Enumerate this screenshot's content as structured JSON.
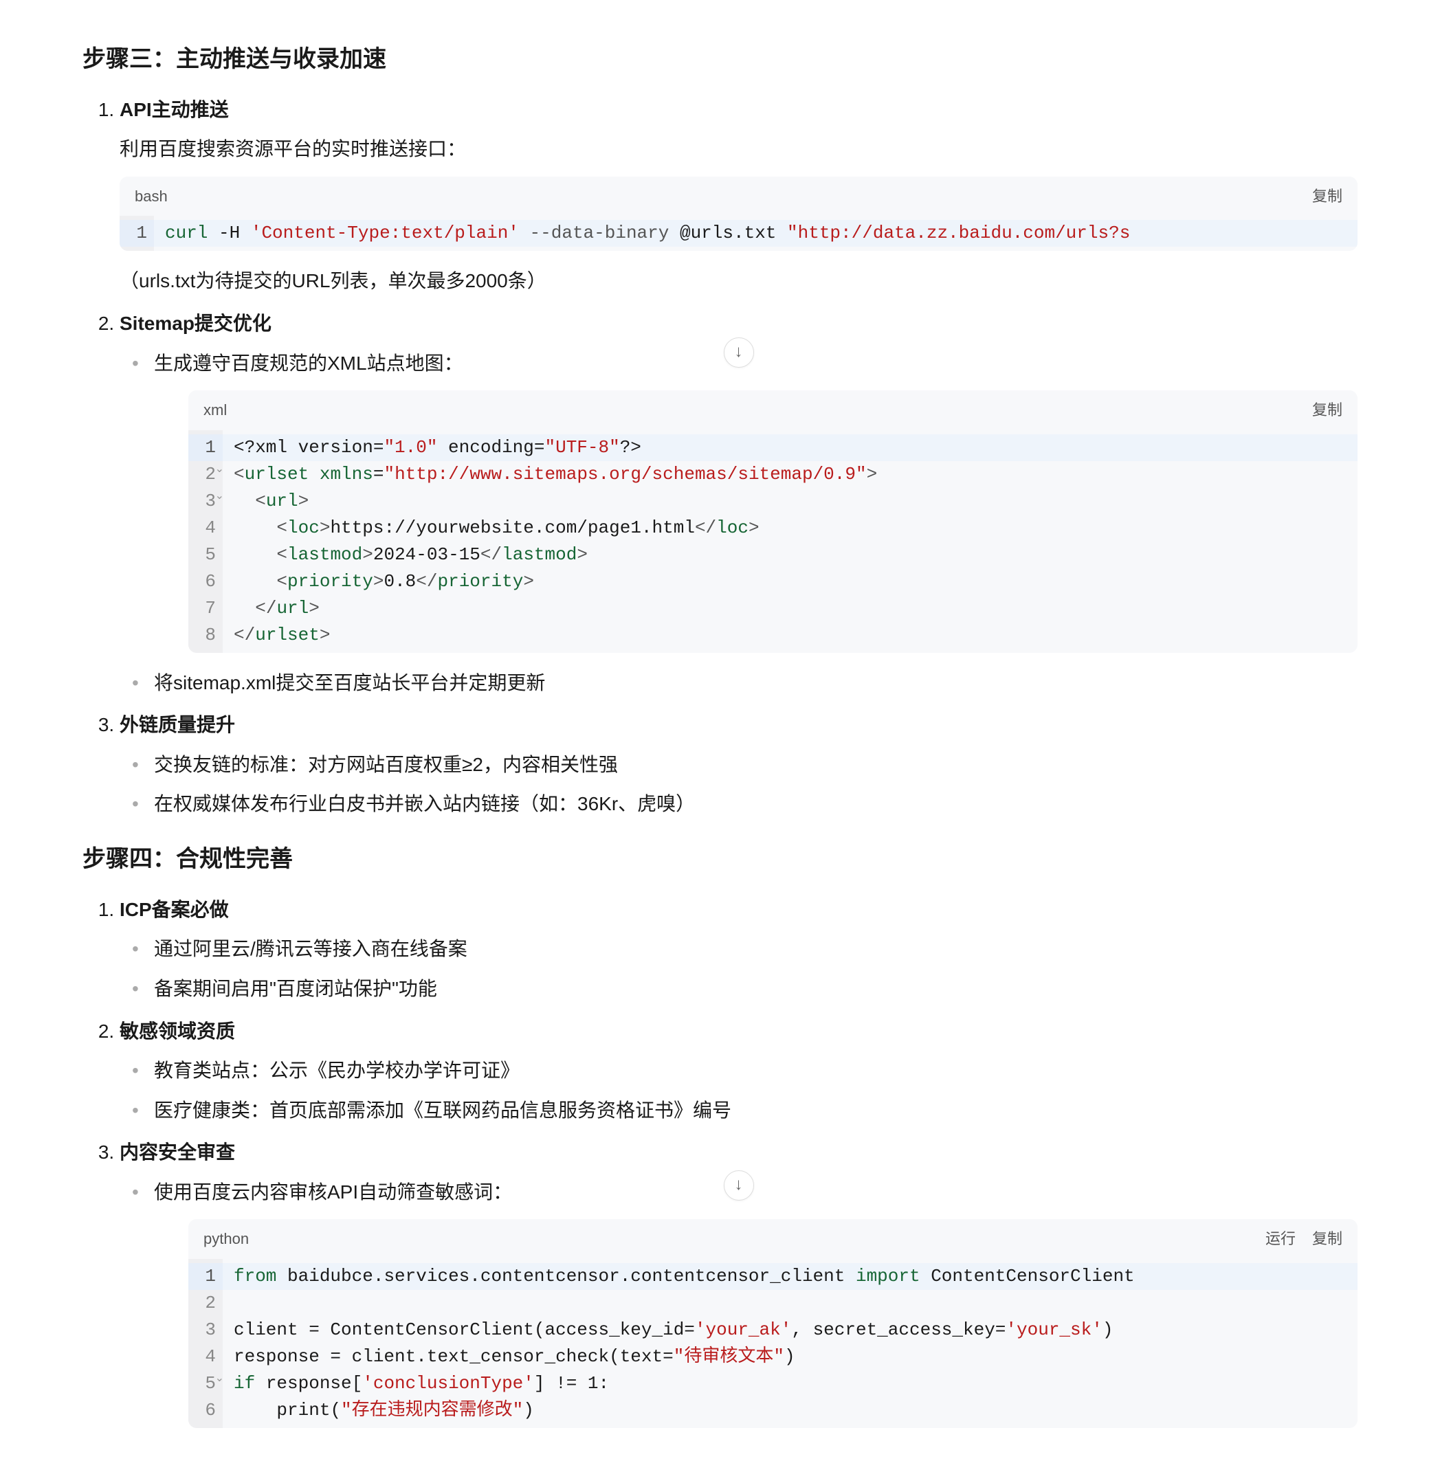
{
  "labels": {
    "copy": "复制",
    "run": "运行"
  },
  "step3": {
    "title": "步骤三：主动推送与收录加速",
    "items": [
      {
        "title": "API主动推送",
        "desc": "利用百度搜索资源平台的实时推送接口：",
        "note": "（urls.txt为待提交的URL列表，单次最多2000条）",
        "code": {
          "lang": "bash",
          "raw": "curl -H 'Content-Type:text/plain' --data-binary @urls.txt \"http://data.zz.baidu.com/urls?s"
        }
      },
      {
        "title": "Sitemap提交优化",
        "sub": [
          {
            "text": "生成遵守百度规范的XML站点地图：",
            "code": {
              "lang": "xml",
              "lines": [
                "<?xml version=\"1.0\" encoding=\"UTF-8\"?>",
                "<urlset xmlns=\"http://www.sitemaps.org/schemas/sitemap/0.9\">",
                "  <url>",
                "    <loc>https://yourwebsite.com/page1.html</loc>",
                "    <lastmod>2024-03-15</lastmod>",
                "    <priority>0.8</priority>",
                "  </url>",
                "</urlset>"
              ]
            }
          },
          {
            "text": "将sitemap.xml提交至百度站长平台并定期更新"
          }
        ]
      },
      {
        "title": "外链质量提升",
        "sub": [
          {
            "text": "交换友链的标准：对方网站百度权重≥2，内容相关性强"
          },
          {
            "text": "在权威媒体发布行业白皮书并嵌入站内链接（如：36Kr、虎嗅）"
          }
        ]
      }
    ]
  },
  "step4": {
    "title": "步骤四：合规性完善",
    "items": [
      {
        "title": "ICP备案必做",
        "sub": [
          {
            "text": "通过阿里云/腾讯云等接入商在线备案"
          },
          {
            "text": "备案期间启用\"百度闭站保护\"功能"
          }
        ]
      },
      {
        "title": "敏感领域资质",
        "sub": [
          {
            "text": "教育类站点：公示《民办学校办学许可证》"
          },
          {
            "text": "医疗健康类：首页底部需添加《互联网药品信息服务资格证书》编号"
          }
        ]
      },
      {
        "title": "内容安全审查",
        "sub": [
          {
            "text": "使用百度云内容审核API自动筛查敏感词：",
            "code": {
              "lang": "python",
              "runnable": true,
              "lines": [
                "from baidubce.services.contentcensor.contentcensor_client import ContentCensorClient",
                "",
                "client = ContentCensorClient(access_key_id='your_ak', secret_access_key='your_sk')",
                "response = client.text_censor_check(text=\"待审核文本\")",
                "if response['conclusionType'] != 1:",
                "    print(\"存在违规内容需修改\")"
              ]
            }
          }
        ]
      }
    ]
  },
  "downArrow": "↓"
}
